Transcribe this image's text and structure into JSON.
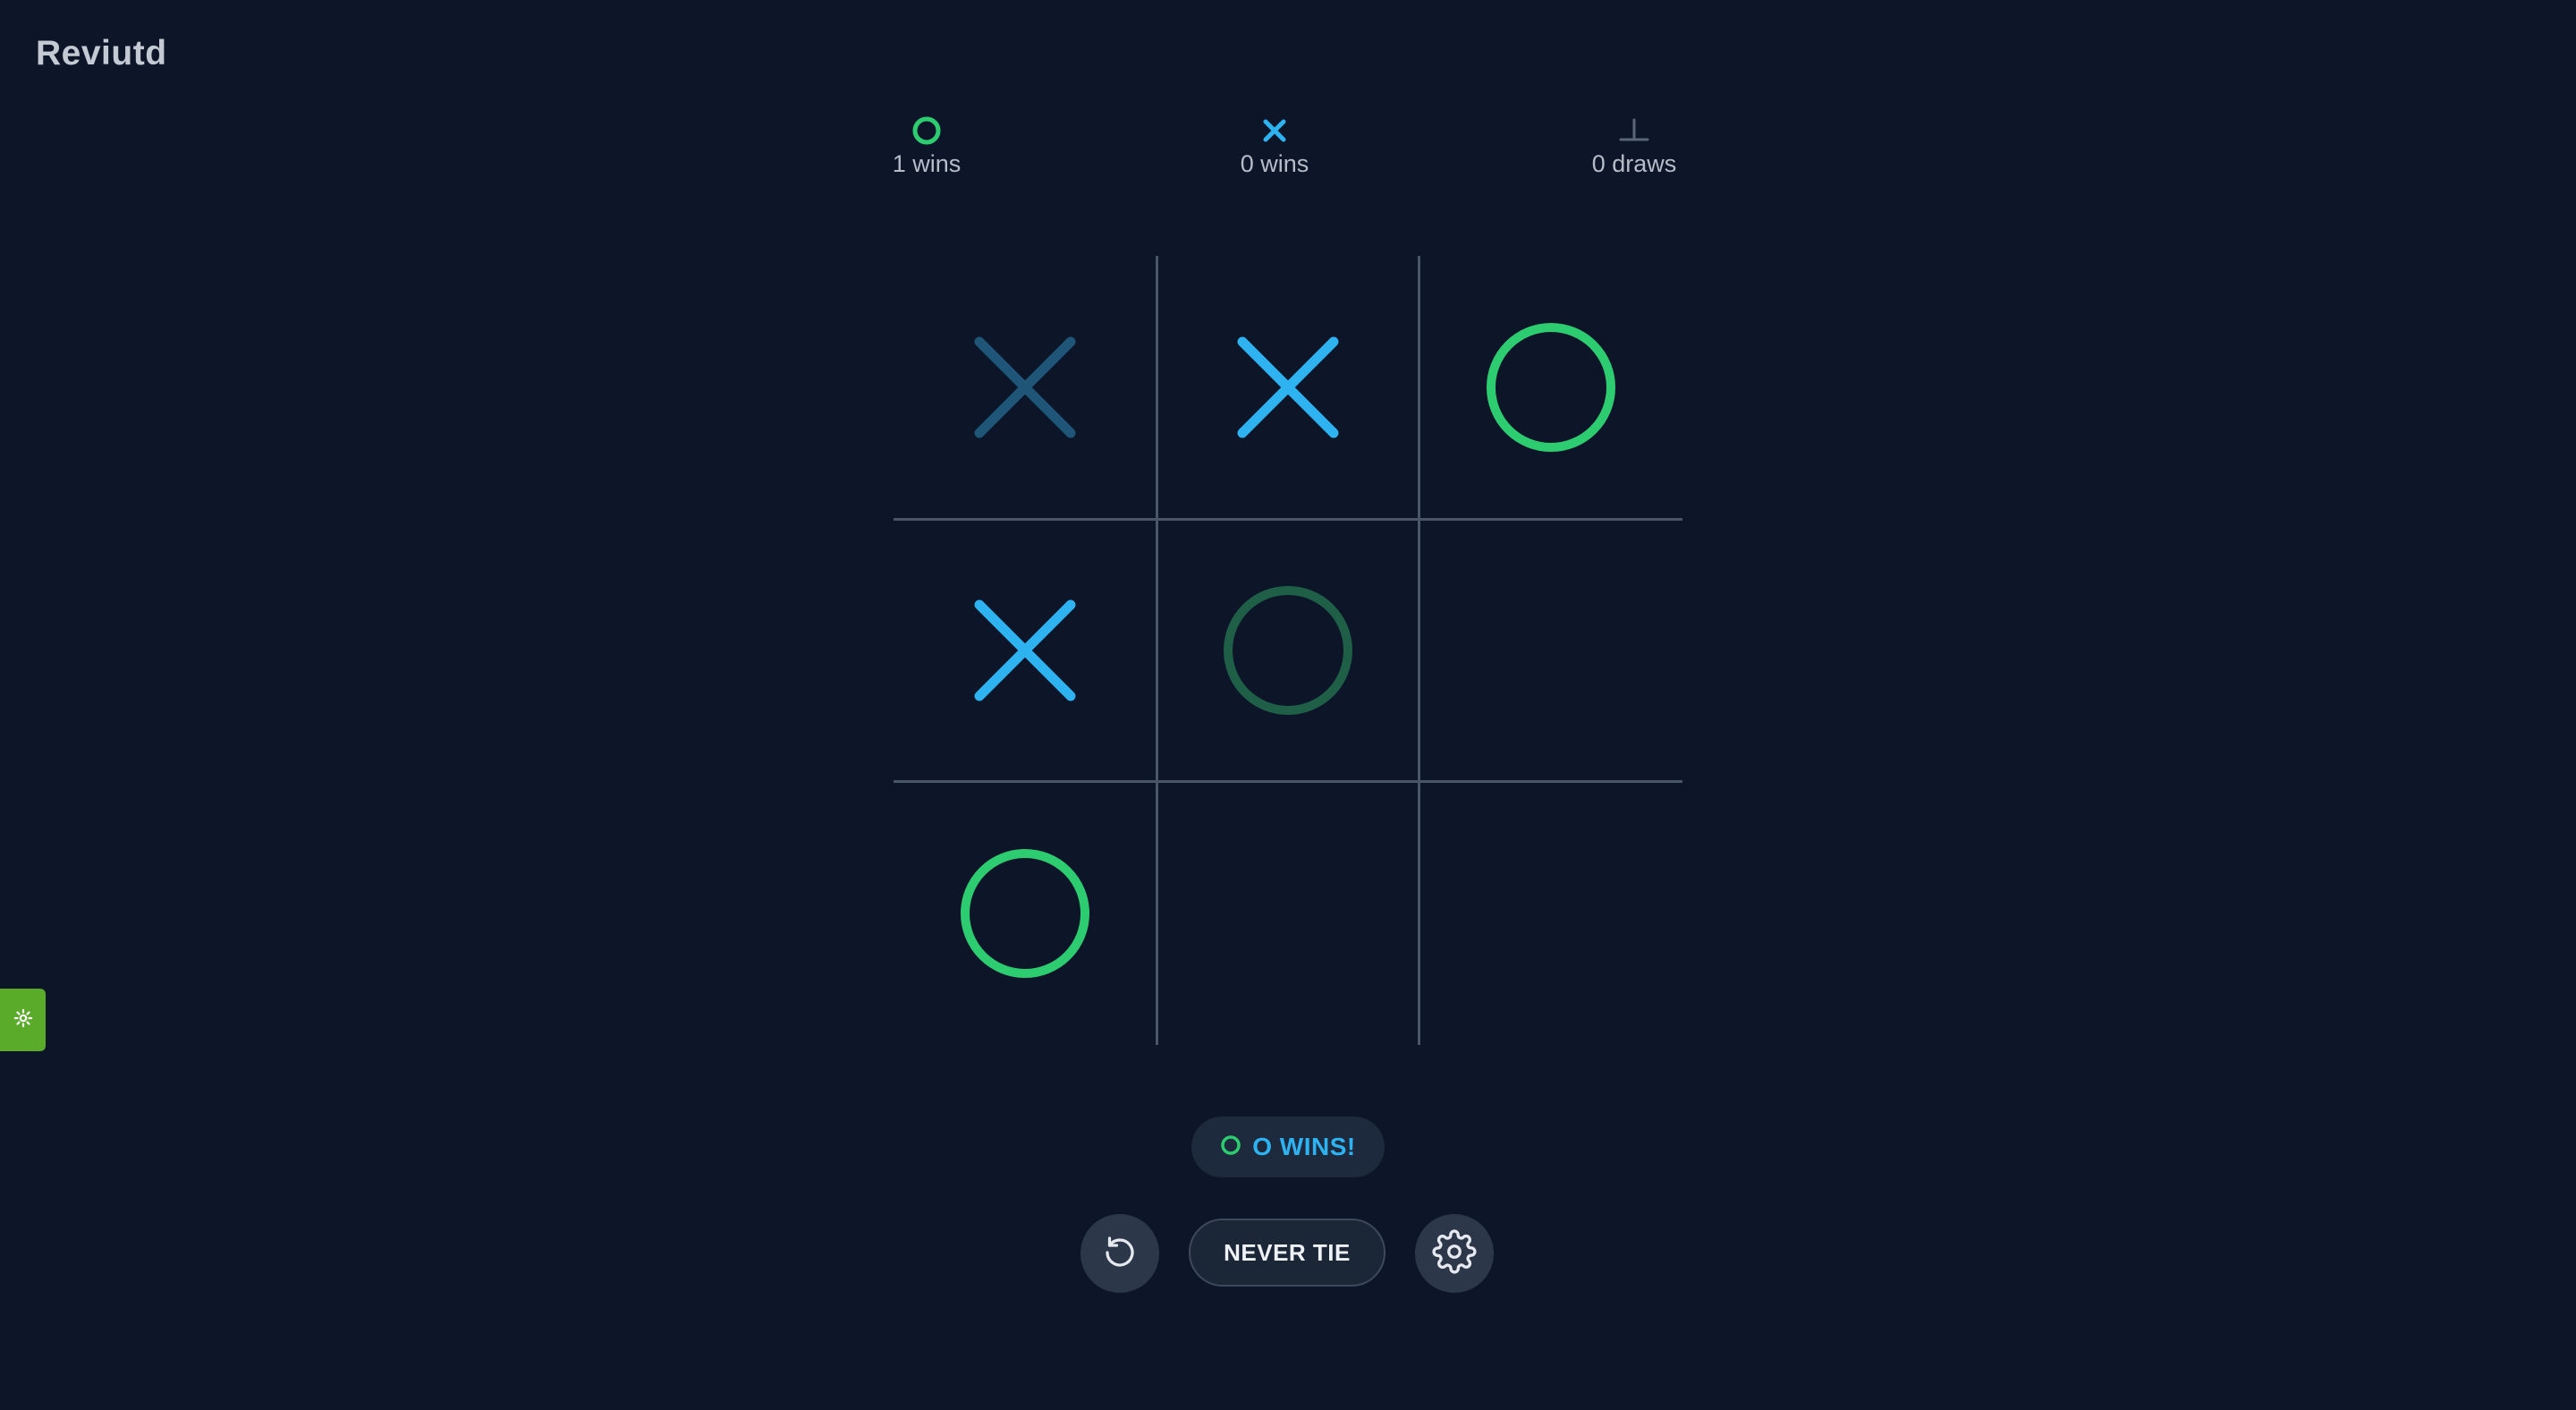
{
  "app": {
    "title": "Reviutd"
  },
  "scoreboard": {
    "o": {
      "icon": "circle-icon",
      "label": "1 wins",
      "wins": 1
    },
    "x": {
      "icon": "x-icon",
      "label": "0 wins",
      "wins": 0
    },
    "draws": {
      "icon": "draw-icon",
      "label": "0 draws",
      "count": 0
    }
  },
  "board": {
    "cells": [
      {
        "mark": "X",
        "faded": true
      },
      {
        "mark": "X",
        "faded": false
      },
      {
        "mark": "O",
        "faded": false
      },
      {
        "mark": "X",
        "faded": false
      },
      {
        "mark": "O",
        "faded": true
      },
      {
        "mark": "",
        "faded": false
      },
      {
        "mark": "O",
        "faded": false
      },
      {
        "mark": "",
        "faded": false
      },
      {
        "mark": "",
        "faded": false
      }
    ]
  },
  "status": {
    "icon": "circle-icon",
    "text": "O WINS!"
  },
  "controls": {
    "reset_icon": "reset-icon",
    "mode_label": "NEVER TIE",
    "settings_icon": "gear-icon"
  },
  "side_tab": {
    "icon": "gear-icon"
  },
  "colors": {
    "background": "#0c1628",
    "x_mark": "#2fb2f0",
    "x_mark_faded": "#1f5678",
    "o_mark": "#2ecc71",
    "o_mark_faded": "#1f5e47",
    "grid": "#4a5567",
    "side_tab": "#5aab2a"
  }
}
